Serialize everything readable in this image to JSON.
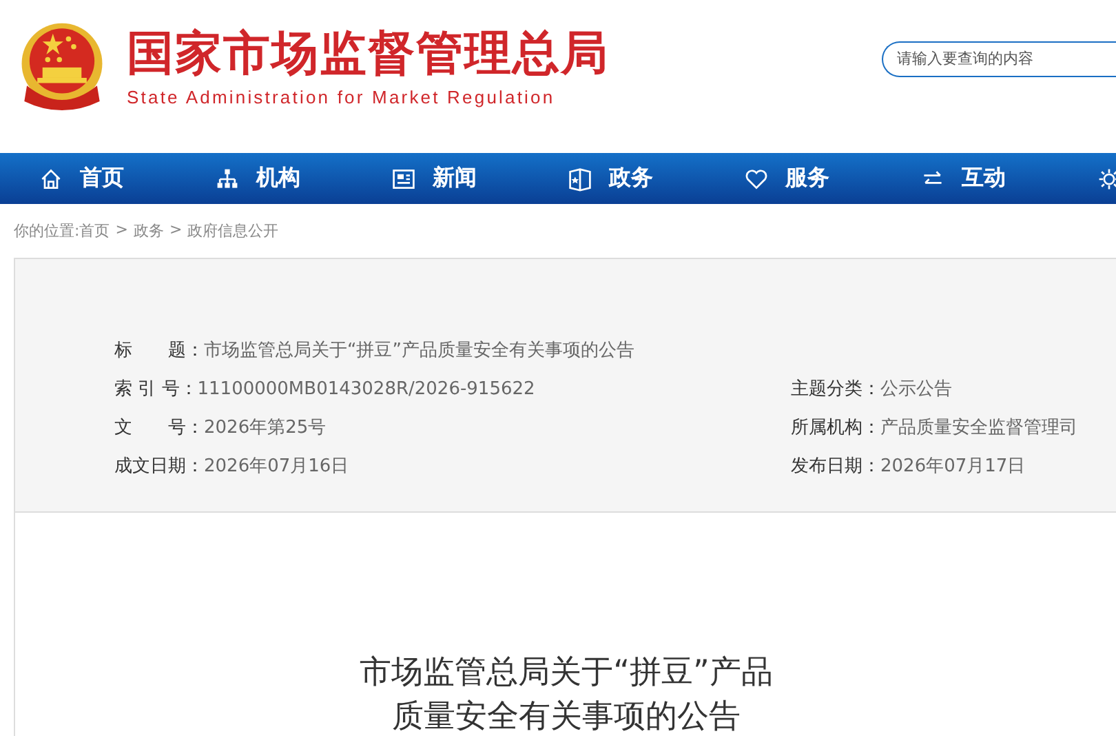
{
  "header": {
    "title": "国家市场监督管理总局",
    "subtitle": "State Administration for Market Regulation",
    "search": {
      "placeholder": "请输入要查询的内容"
    }
  },
  "nav": [
    {
      "kind": "home",
      "label": "首页"
    },
    {
      "kind": "org",
      "label": "机构"
    },
    {
      "kind": "news",
      "label": "新闻"
    },
    {
      "kind": "affairs",
      "label": "政务"
    },
    {
      "kind": "service",
      "label": "服务"
    },
    {
      "kind": "interact",
      "label": "互动"
    },
    {
      "kind": "more"
    }
  ],
  "breadcrumb": [
    {
      "label": "你的位置:首页"
    },
    {
      "label": "政务"
    },
    {
      "label": "政府信息公开"
    }
  ],
  "breadcrumb_separator": ">",
  "info": {
    "rows": [
      [
        {
          "label": "标　　题：",
          "value": "市场监管总局关于“拼豆”产品质量安全有关事项的公告"
        }
      ],
      [
        {
          "label": "索 引 号：",
          "value": "11100000MB0143028R/2026-915622"
        },
        {
          "label": "主题分类：",
          "value": "公示公告"
        }
      ],
      [
        {
          "label": "文　　号：",
          "value": "2026年第25号"
        },
        {
          "label": "所属机构：",
          "value": "产品质量安全监督管理司"
        }
      ],
      [
        {
          "label": "成文日期：",
          "value": "2026年07月16日"
        },
        {
          "label": "发布日期：",
          "value": "2026年07月17日"
        }
      ]
    ]
  },
  "article": {
    "title_lines": [
      "市场监管总局关于“拼豆”产品",
      "质量安全有关事项的公告"
    ]
  }
}
